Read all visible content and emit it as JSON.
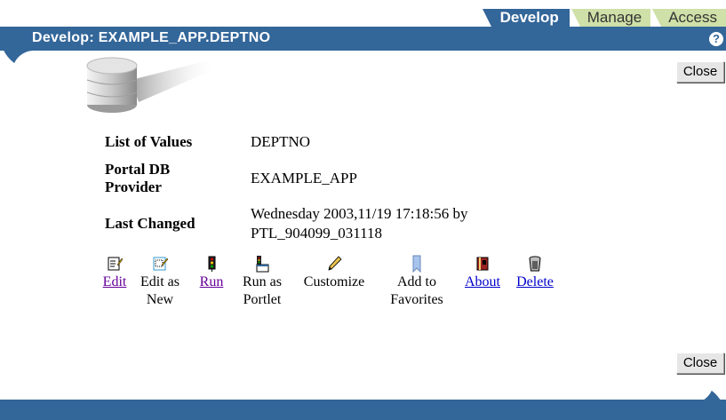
{
  "tabs": [
    {
      "label": "Develop",
      "active": true
    },
    {
      "label": "Manage",
      "active": false
    },
    {
      "label": "Access",
      "active": false
    }
  ],
  "header": {
    "title": "Develop: EXAMPLE_APP.DEPTNO",
    "help_icon": "help-icon",
    "help_glyph": "?"
  },
  "buttons": {
    "close_top": "Close",
    "close_bottom": "Close"
  },
  "info": {
    "list_of_values_label": "List of Values",
    "list_of_values_value": "DEPTNO",
    "provider_label_line1": "Portal DB",
    "provider_label_line2": "Provider",
    "provider_value": "EXAMPLE_APP",
    "last_changed_label": "Last Changed",
    "last_changed_line1": "Wednesday 2003,11/19 17:18:56 by",
    "last_changed_line2": "PTL_904099_031118"
  },
  "actions": [
    {
      "line1": "Edit",
      "line2": "",
      "icon": "edit-icon",
      "link": true
    },
    {
      "line1": "Edit as",
      "line2": "New",
      "icon": "edit-as-new-icon",
      "link": false
    },
    {
      "line1": "Run",
      "line2": "",
      "icon": "run-icon",
      "link": true
    },
    {
      "line1": "Run as",
      "line2": "Portlet",
      "icon": "run-as-portlet-icon",
      "link": false
    },
    {
      "line1": "Customize",
      "line2": "",
      "icon": "customize-icon",
      "link": false
    },
    {
      "line1": "Add to",
      "line2": "Favorites",
      "icon": "add-to-favorites-icon",
      "link": false
    },
    {
      "line1": "About",
      "line2": "",
      "icon": "about-icon",
      "link": true
    },
    {
      "line1": "Delete",
      "line2": "",
      "icon": "delete-icon",
      "link": true
    }
  ],
  "colors": {
    "brand_blue": "#336699",
    "tab_inactive": "#cfe0a8",
    "link_visited": "#660099",
    "link": "#0000cc"
  }
}
